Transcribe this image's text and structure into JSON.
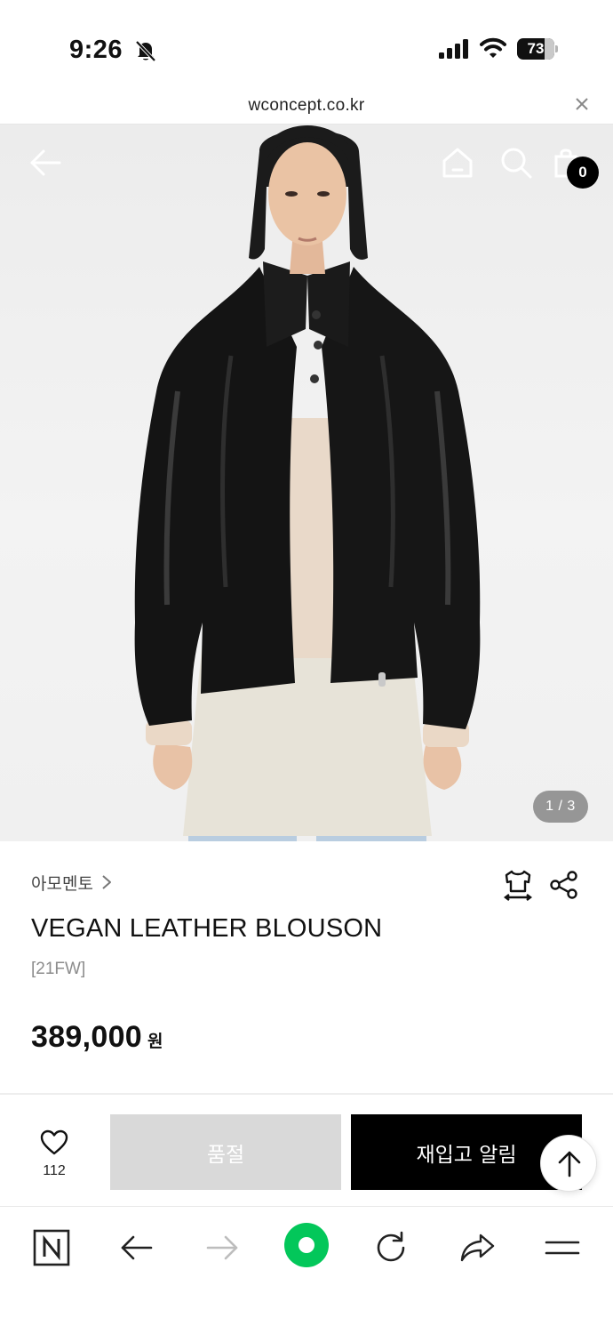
{
  "status_bar": {
    "time": "9:26",
    "battery_level": "73",
    "battery_fraction": 0.73
  },
  "browser": {
    "url": "wconcept.co.kr"
  },
  "hero": {
    "cart_count": "0",
    "page_indicator": "1 / 3"
  },
  "product": {
    "brand": "아모멘토",
    "title": "VEGAN LEATHER BLOUSON",
    "season": "[21FW]",
    "price": "389,000",
    "currency": "원"
  },
  "purchase_bar": {
    "wish_count": "112",
    "soldout_label": "품절",
    "restock_label": "재입고 알림"
  },
  "icons": {
    "status": [
      "bell-slash-icon",
      "signal-icon",
      "wifi-icon",
      "battery-icon"
    ],
    "hero": [
      "back-arrow-icon",
      "home-icon",
      "search-icon",
      "shopping-bag-icon"
    ],
    "product": [
      "chevron-right-icon",
      "size-guide-icon",
      "share-icon"
    ],
    "purchase": [
      "heart-icon",
      "arrow-up-icon"
    ],
    "toolbar": [
      "naver-n-icon",
      "back-icon",
      "forward-icon",
      "green-dot-icon",
      "reload-icon",
      "share-icon",
      "menu-icon"
    ]
  },
  "colors": {
    "accent_green": "#03c75a",
    "soldout_gray": "#d9d9d9",
    "restock_black": "#000000"
  }
}
